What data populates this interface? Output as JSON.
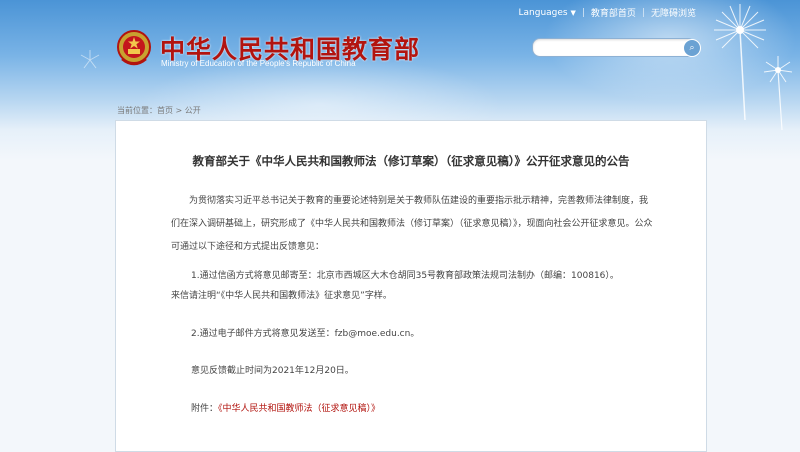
{
  "header": {
    "title": "中华人民共和国教育部",
    "subtitle": "Ministry of Education of the People's Republic of China",
    "top_links": {
      "languages": "Languages",
      "home": "教育部首页",
      "accessibility": "无障碍浏览"
    },
    "search": {
      "placeholder": "",
      "button_icon": "search-icon"
    }
  },
  "breadcrumb": {
    "prefix": "当前位置：",
    "home": "首页",
    "separator": ">",
    "current": "公开"
  },
  "article": {
    "title": "教育部关于《中华人民共和国教师法（修订草案）（征求意见稿）》公开征求意见的公告",
    "intro": "为贯彻落实习近平总书记关于教育的重要论述特别是关于教师队伍建设的重要指示批示精神，完善教师法律制度，我们在深入调研基础上，研究形成了《中华人民共和国教师法（修订草案）（征求意见稿）》，现面向社会公开征求意见。公众可通过以下途径和方式提出反馈意见：",
    "item1_line1": "1.通过信函方式将意见邮寄至：北京市西城区大木仓胡同35号教育部政策法规司法制办（邮编：100816）。",
    "item1_line2": "来信请注明“《中华人民共和国教师法》征求意见”字样。",
    "item2": "2.通过电子邮件方式将意见发送至：fzb@moe.edu.cn。",
    "deadline": "意见反馈截止时间为2021年12月20日。",
    "attachment_label": "附件：",
    "attachment_link": "《中华人民共和国教师法（征求意见稿）》"
  },
  "colors": {
    "brand_red": "#b2140f",
    "sky_blue": "#4b94d6",
    "link_red": "#b2140f"
  }
}
